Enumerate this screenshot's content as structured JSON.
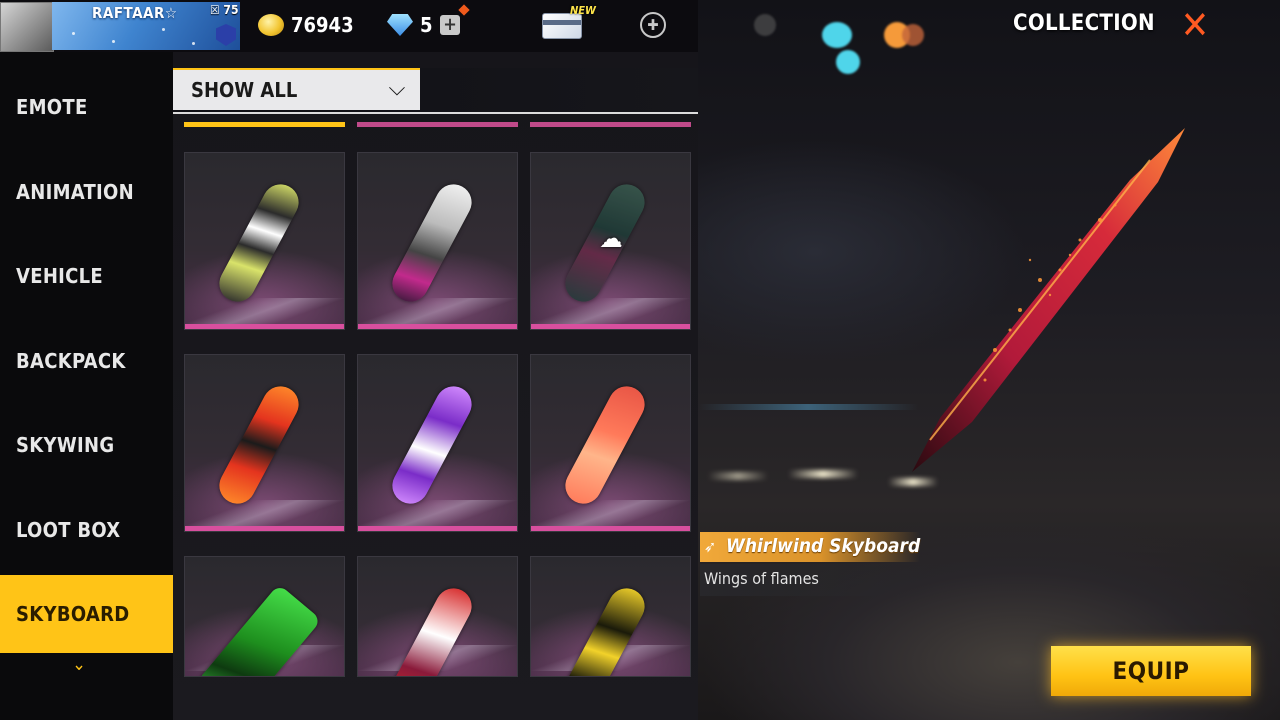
{
  "header": {
    "player_name": "RAFTAAR☆",
    "player_level": "☒ 75",
    "coins": "76943",
    "diamonds": "5",
    "new_tag": "NEW",
    "title": "COLLECTION"
  },
  "sidebar": {
    "items": [
      {
        "label": "EMOTE"
      },
      {
        "label": "ANIMATION"
      },
      {
        "label": "VEHICLE"
      },
      {
        "label": "BACKPACK"
      },
      {
        "label": "SKYWING"
      },
      {
        "label": "LOOT BOX"
      },
      {
        "label": "SKYBOARD",
        "active": true
      }
    ]
  },
  "filter": {
    "selected": "SHOW ALL"
  },
  "grid": {
    "items": [
      {
        "name": "skyboard-item-1",
        "colors": [
          "#2b2b2b",
          "#d9e36a",
          "#ffffff"
        ],
        "selected": true
      },
      {
        "name": "skyboard-item-2",
        "colors": [
          "#e8e8e8",
          "#444444",
          "#c22a8c"
        ]
      },
      {
        "name": "skyboard-item-3",
        "colors": [
          "#1d3b36",
          "#3a5c50",
          "#6b2a4a"
        ],
        "downloadable": true
      },
      {
        "name": "skyboard-item-4",
        "colors": [
          "#e4341e",
          "#ff8a2a",
          "#1b1b1b"
        ]
      },
      {
        "name": "skyboard-item-5",
        "colors": [
          "#7a2cc8",
          "#d38cff",
          "#ffffff"
        ]
      },
      {
        "name": "skyboard-item-6",
        "colors": [
          "#ff7a5a",
          "#e85545",
          "#ffb58a"
        ]
      },
      {
        "name": "skyboard-item-7",
        "colors": [
          "#1e8f1e",
          "#46e04a",
          "#0e3a10"
        ]
      },
      {
        "name": "skyboard-item-8",
        "colors": [
          "#d62a2a",
          "#ffffff",
          "#8a1a3a"
        ]
      },
      {
        "name": "skyboard-item-9",
        "colors": [
          "#1a1a0a",
          "#f2d22a",
          "#6b5a10"
        ]
      }
    ]
  },
  "detail": {
    "item_name": "Whirlwind Skyboard",
    "item_desc": "Wings of flames",
    "equip_label": "EQUIP"
  },
  "colors": {
    "accent": "#ffc417",
    "close": "#ff5a22",
    "card_underline": "#d84f9e"
  }
}
